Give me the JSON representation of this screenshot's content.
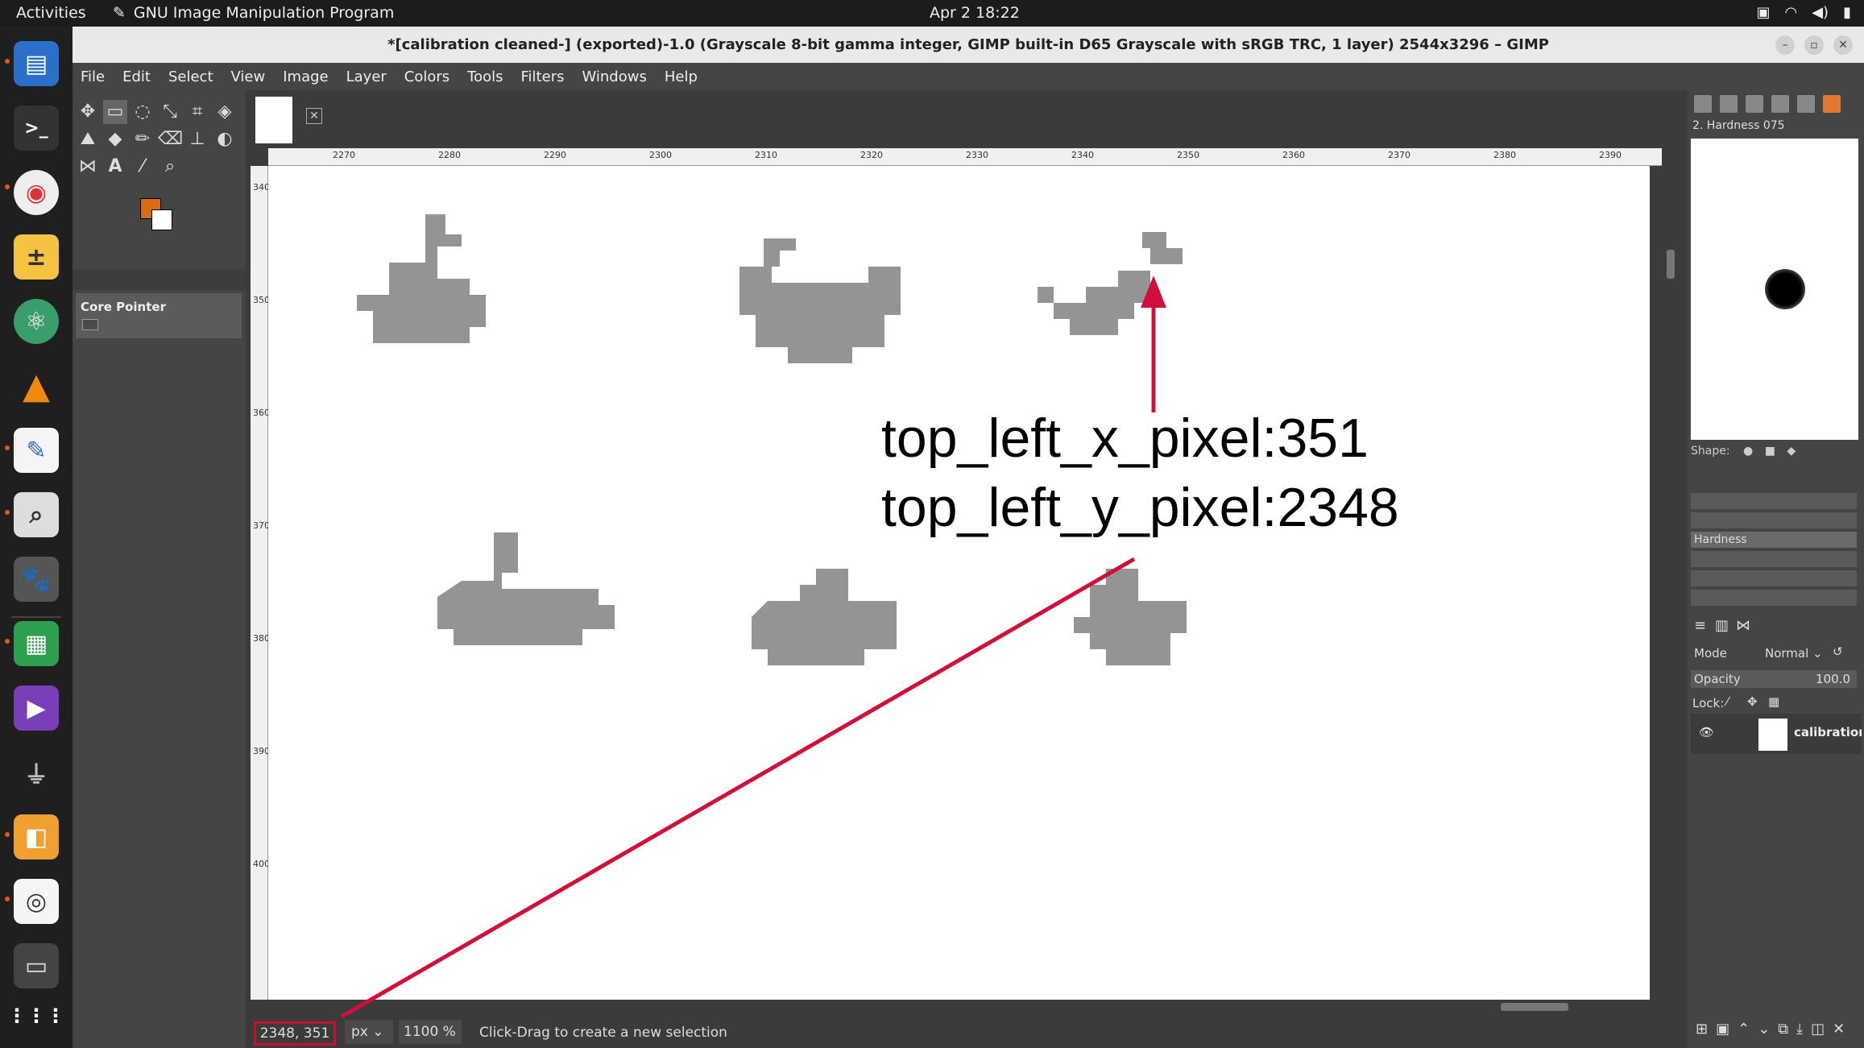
{
  "topbar": {
    "activities": "Activities",
    "app_name": "GNU Image Manipulation Program",
    "clock": "Apr 2  18:22"
  },
  "window": {
    "title": "*[calibration cleaned-] (exported)-1.0 (Grayscale 8-bit gamma integer, GIMP built-in D65 Grayscale with sRGB TRC, 1 layer) 2544x3296 – GIMP"
  },
  "menu": [
    "File",
    "Edit",
    "Select",
    "View",
    "Image",
    "Layer",
    "Colors",
    "Tools",
    "Filters",
    "Windows",
    "Help"
  ],
  "toolbox": {
    "device_status_label": "Core Pointer",
    "fg_color": "#d86b15",
    "bg_color": "#ffffff"
  },
  "ruler": {
    "labels": [
      "2270",
      "2280",
      "2290",
      "2300",
      "2310",
      "2320",
      "2330",
      "2340",
      "2350",
      "2360",
      "2370",
      "2380",
      "2390"
    ],
    "vertical_labels": [
      "340",
      "350",
      "360",
      "370",
      "380",
      "390",
      "400"
    ]
  },
  "statusbar": {
    "coords": "2348, 351",
    "unit": "px",
    "zoom": "1100 %",
    "message": "Click-Drag to create a new selection"
  },
  "brushes": {
    "name": "2. Hardness 075",
    "shape_label": "Shape:",
    "hardness_label": "Hardness"
  },
  "layers": {
    "mode_label": "Mode",
    "mode_value": "Normal",
    "opacity_label": "Opacity",
    "opacity_value": "100.0",
    "lock_label": "Lock:",
    "layer_name": "calibration-jpg"
  },
  "annotation": {
    "line1": "top_left_x_pixel:351",
    "line2": "top_left_y_pixel:2348",
    "color": "#d0103a"
  }
}
